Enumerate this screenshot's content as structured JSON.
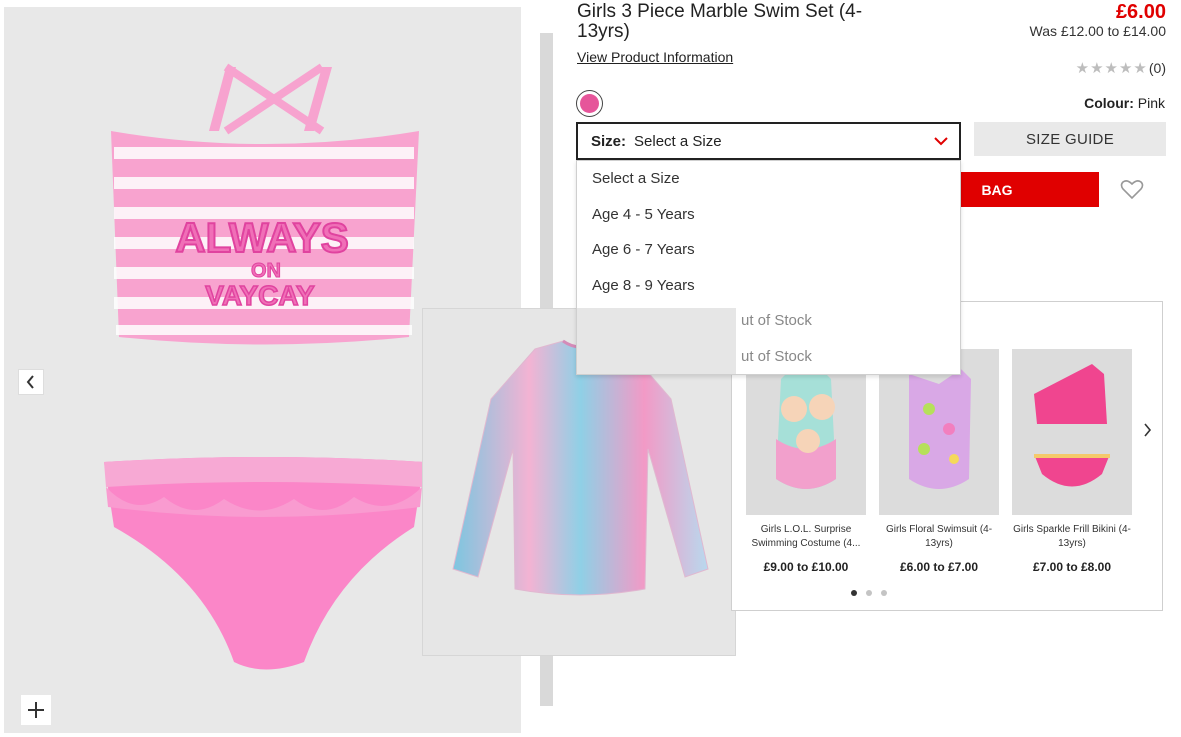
{
  "product": {
    "title": "Girls 3 Piece Marble Swim Set (4-13yrs)",
    "price": "£6.00",
    "was_price": "Was £12.00 to £14.00",
    "view_info": "View Product Information",
    "rating_count": "(0)",
    "rating_value": 0,
    "colour_label": "Colour:",
    "colour_value": "Pink",
    "swatch_color": "#e6559a"
  },
  "size": {
    "label": "Size:",
    "value": "Select a Size",
    "guide": "SIZE GUIDE",
    "options": [
      {
        "label": "Select a Size"
      },
      {
        "label": "Age 4 - 5 Years"
      },
      {
        "label": "Age 6 - 7 Years"
      },
      {
        "label": "Age 8 - 9 Years"
      },
      {
        "label": "ut of Stock"
      },
      {
        "label": "ut of Stock"
      }
    ]
  },
  "actions": {
    "add_to_bag": "BAG"
  },
  "gallery": {
    "prev_icon": "chevron-left-icon",
    "zoom_icon": "plus-icon",
    "top_text_line1": "ALWAYS",
    "top_text_line2": "ON",
    "top_text_line3": "VAYCAY"
  },
  "recommendations": {
    "items": [
      {
        "name": "Girls L.O.L. Surprise Swimming Costume (4...",
        "price": "£9.00 to £10.00"
      },
      {
        "name": "Girls Floral Swimsuit (4-13yrs)",
        "price": "£6.00 to £7.00"
      },
      {
        "name": "Girls Sparkle Frill Bikini (4-13yrs)",
        "price": "£7.00 to £8.00"
      }
    ],
    "dots": 3,
    "active_dot": 0
  },
  "colors": {
    "accent_red": "#e00000",
    "pink": "#f58cc4",
    "button_grey": "#e9e9e9"
  }
}
